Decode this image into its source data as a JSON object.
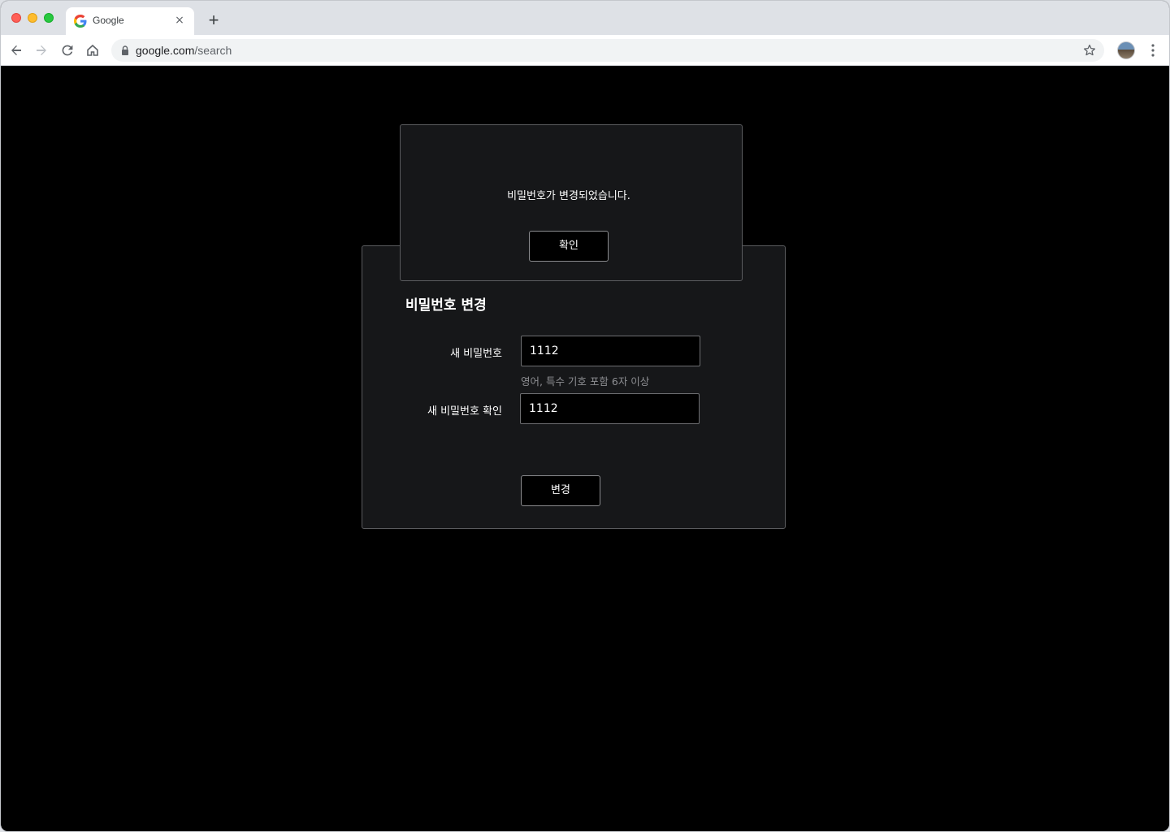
{
  "browser": {
    "tab_title": "Google",
    "new_tab_symbol": "+",
    "close_symbol": "×",
    "url_host": "google.com",
    "url_path": "/search"
  },
  "panel": {
    "title": "비밀번호 변경",
    "new_password_label": "새 비밀번호",
    "new_password_value": "1112",
    "hint": "영어, 특수 기호 포함 6자 이상",
    "confirm_label": "새 비밀번호 확인",
    "confirm_value": "1112",
    "change_button": "변경"
  },
  "modal": {
    "message": "비밀번호가 변경되었습니다.",
    "ok_button": "확인"
  },
  "colors": {
    "page_background": "#000000",
    "panel_background": "#161719",
    "border": "#5a5b5e",
    "hint_text": "#8e8f93"
  }
}
